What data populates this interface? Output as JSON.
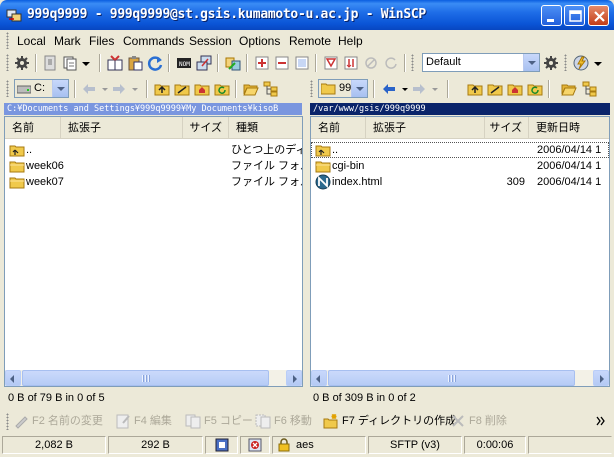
{
  "window": {
    "title": "999q9999 - 999q9999@st.gsis.kumamoto-u.ac.jp - WinSCP"
  },
  "menu": [
    "Local",
    "Mark",
    "Files",
    "Commands",
    "Session",
    "Options",
    "Remote",
    "Help"
  ],
  "toolbar": {
    "profile_combo": "Default"
  },
  "local": {
    "drive_combo": "C:",
    "path": "C:¥Documents and Settings¥999q9999¥My Documents¥kisoB",
    "columns": [
      "名前",
      "拡張子",
      "サイズ",
      "種類"
    ],
    "rows": [
      {
        "name": "..",
        "size": "",
        "type": "ひとつ上のディレ",
        "icon": "parent-folder-icon"
      },
      {
        "name": "week06",
        "size": "",
        "type": "ファイル フォルダ",
        "icon": "folder-icon"
      },
      {
        "name": "week07",
        "size": "",
        "type": "ファイル フォルダ",
        "icon": "folder-icon"
      }
    ],
    "status": "0 B of 79 B in 0 of 5"
  },
  "remote": {
    "dir_combo": "99",
    "path": "/var/www/gsis/999q9999",
    "columns": [
      "名前",
      "拡張子",
      "サイズ",
      "更新日時"
    ],
    "rows": [
      {
        "name": "..",
        "size": "",
        "modified": "2006/04/14 1",
        "icon": "parent-folder-icon"
      },
      {
        "name": "cgi-bin",
        "size": "",
        "modified": "2006/04/14 1",
        "icon": "folder-icon"
      },
      {
        "name": "index.html",
        "size": "309",
        "modified": "2006/04/14 1",
        "icon": "html-file-icon"
      }
    ],
    "status": "0 B of 309 B in 0 of 2"
  },
  "commands": [
    {
      "label": "F2 名前の変更",
      "enabled": false
    },
    {
      "label": "F4 編集",
      "enabled": false
    },
    {
      "label": "F5 コピー",
      "enabled": false
    },
    {
      "label": "F6 移動",
      "enabled": false
    },
    {
      "label": "F7 ディレクトリの作成",
      "enabled": true
    },
    {
      "label": "F8 削除",
      "enabled": false
    }
  ],
  "statusbar": {
    "uploaded": "2,082 B",
    "downloaded": "292 B",
    "cipher": "aes",
    "protocol": "SFTP (v3)",
    "duration": "0:00:06"
  },
  "colors": {
    "title_blue": "#0a5ee0",
    "path_active": "#0a246a",
    "path_inactive": "#7a96df",
    "chrome": "#ece9d8"
  }
}
